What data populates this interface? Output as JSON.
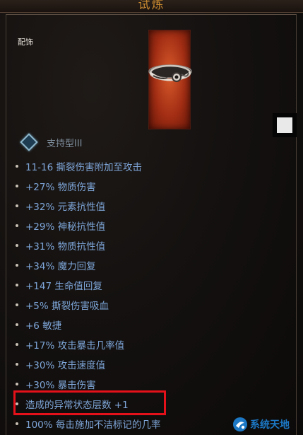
{
  "header": {
    "title": "试炼"
  },
  "item": {
    "category": "配饰",
    "type_label": "支持型III"
  },
  "mods": [
    "11-16 撕裂伤害附加至攻击",
    "+27% 物质伤害",
    "+32% 元素抗性值",
    "+29% 神秘抗性值",
    "+31% 物质抗性值",
    "+34% 魔力回复",
    "+147 生命值回复",
    "+5% 撕裂伤害吸血",
    "+6 敏捷",
    "+17% 攻击暴击几率值",
    "+30% 攻击速度值",
    "+30% 暴击伤害",
    "造成的异常状态层数 +1",
    "100% 每击施加不洁标记的几率"
  ],
  "highlighted_mod_index": 12,
  "watermark": {
    "text": "系统天地",
    "icon": "watermark-logo-icon"
  },
  "colors": {
    "title": "#c7882f",
    "mod_text": "#7ea6d8",
    "highlight": "#e4111a",
    "item_bg": "#a32e14"
  }
}
